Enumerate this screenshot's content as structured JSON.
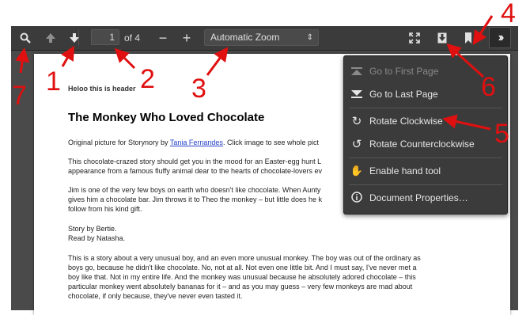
{
  "toolbar": {
    "page_number": "1",
    "page_count": "of 4",
    "zoom": "Automatic Zoom"
  },
  "document": {
    "header": "Heloo this is header",
    "title": "The Monkey Who Loved Chocolate",
    "p1_prefix": "Original picture for Storynory by ",
    "p1_link": "Tania Fernandes",
    "p1_suffix": ". Click image to see whole pict",
    "p2_l1": "This chocolate-crazed story should get you in the mood for an Easter-egg hunt L",
    "p2_l2": "appearance from a famous fluffy animal dear to the hearts of chocolate-lovers ev",
    "p3_l1": "Jim is one of the very few boys on earth who doesn't like chocolate. When Aunty",
    "p3_l2": "gives him a chocolate bar. Jim throws it to Theo the monkey – but little does he k",
    "p3_l3": "follow from his kind gift.",
    "p4_l1": "Story by Bertie.",
    "p4_l2": "Read by Natasha.",
    "p5_l1": "This is a story about a very unusual boy, and an even more unusual monkey. The boy was out of the ordinary as",
    "p5_l2": "boys go, because he didn't like chocolate. No, not at all. Not even one little bit. And I must say, I've never met a",
    "p5_l3": "boy like that. Not in my entire life. And the monkey was unusual because he absolutely adored chocolate – this",
    "p5_l4": "particular monkey went absolutely bananas for it – and as you may guess – very few monkeys are mad about",
    "p5_l5": "chocolate, if only because, they've never even tasted it."
  },
  "menu": {
    "first_page": "Go to First Page",
    "last_page": "Go to Last Page",
    "rotate_cw": "Rotate Clockwise",
    "rotate_ccw": "Rotate Counterclockwise",
    "hand_tool": "Enable hand tool",
    "properties": "Document Properties…"
  },
  "annotations": {
    "n1": "1",
    "n2": "2",
    "n3": "3",
    "n4": "4",
    "n5": "5",
    "n6": "6",
    "n7": "7"
  },
  "colors": {
    "toolbar": "#3b3b3b",
    "annotation": "#e01010",
    "link": "#2340c8"
  }
}
